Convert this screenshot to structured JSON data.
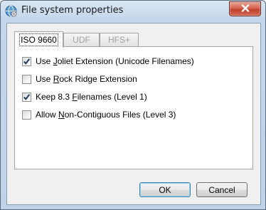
{
  "window": {
    "title": "File system properties",
    "icon": "globe-disc-icon",
    "close_icon": "close-x-icon"
  },
  "tabs": [
    {
      "label": "ISO 9660",
      "state": "active"
    },
    {
      "label": "UDF",
      "state": "disabled"
    },
    {
      "label": "HFS+",
      "state": "disabled"
    }
  ],
  "options": [
    {
      "pre": "Use ",
      "mnemonic": "J",
      "post": "oliet Extension (Unicode Filenames)",
      "checked": true
    },
    {
      "pre": "Use ",
      "mnemonic": "R",
      "post": "ock Ridge Extension",
      "checked": false
    },
    {
      "pre": "Keep 8.3 ",
      "mnemonic": "F",
      "post": "ilenames (Level 1)",
      "checked": true
    },
    {
      "pre": "Allow ",
      "mnemonic": "N",
      "post": "on-Contiguous Files (Level 3)",
      "checked": false
    }
  ],
  "buttons": {
    "ok_label": "OK",
    "cancel_label": "Cancel"
  },
  "colors": {
    "title_bar": "#c3d6ea",
    "close_button": "#c0412c",
    "dialog_background": "#f0f0f0",
    "panel_background": "#ffffff",
    "checkmark": "#1e3a5f",
    "default_button_border": "#3c7fb1"
  }
}
